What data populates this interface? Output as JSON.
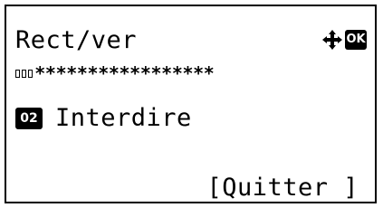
{
  "screen": {
    "title": "Rect/ver",
    "nav_icon": "four-way-arrow-icon",
    "ok_label": "OK",
    "password_mask": "*****************",
    "option": {
      "number": "02",
      "label": "Interdire"
    },
    "softkey_label": "[Quitter ]"
  }
}
